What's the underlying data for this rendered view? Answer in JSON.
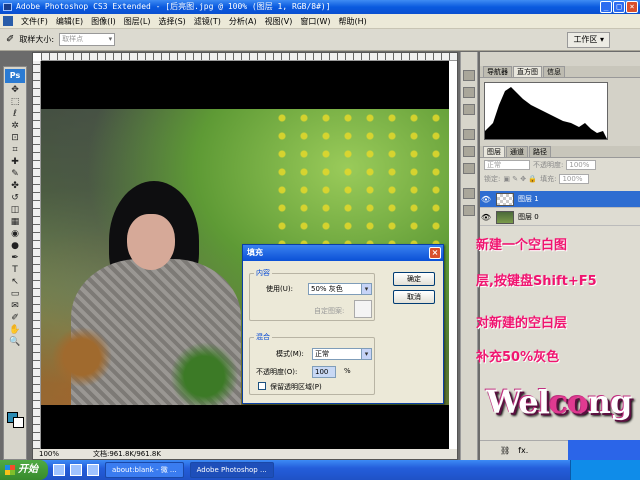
{
  "window": {
    "title": "Adobe Photoshop CS3 Extended - [后亮图.jpg @ 100% (图层 1, RGB/8#)]",
    "minimize_glyph": "_",
    "maximize_glyph": "□",
    "close_glyph": "×"
  },
  "menubar": {
    "items": [
      "文件(F)",
      "编辑(E)",
      "图像(I)",
      "图层(L)",
      "选择(S)",
      "滤镜(T)",
      "分析(A)",
      "视图(V)",
      "窗口(W)",
      "帮助(H)"
    ]
  },
  "options_bar": {
    "sample_size_label": "取样大小:",
    "sample_size_value": "取样点",
    "workspace_label": "工作区 ▾"
  },
  "toolbox": {
    "logo": "Ps",
    "tools": [
      "move-icon",
      "marquee-icon",
      "lasso-icon",
      "magic-wand-icon",
      "crop-icon",
      "slice-icon",
      "healing-icon",
      "brush-icon",
      "stamp-icon",
      "history-brush-icon",
      "eraser-icon",
      "gradient-icon",
      "blur-icon",
      "dodge-icon",
      "pen-icon",
      "type-icon",
      "path-select-icon",
      "shape-icon",
      "notes-icon",
      "eyedropper-icon",
      "hand-icon",
      "zoom-icon"
    ],
    "tool_glyphs": [
      "✥",
      "⬚",
      "ℓ",
      "✲",
      "⊡",
      "⌗",
      "✚",
      "✎",
      "✤",
      "↺",
      "◫",
      "▦",
      "◉",
      "●",
      "✒",
      "T",
      "↖",
      "▭",
      "✉",
      "✐",
      "✋",
      "🔍"
    ],
    "fg_color": "#2a8bb4",
    "bg_color": "#ffffff"
  },
  "document": {
    "zoom": "100%",
    "info": "文档:961.8K/961.8K"
  },
  "fill_dialog": {
    "title": "填充",
    "close_glyph": "×",
    "contents_group": "内容",
    "use_label": "使用(U):",
    "use_value": "50% 灰色",
    "custom_pattern_label": "自定图案:",
    "blending_group": "混合",
    "mode_label": "模式(M):",
    "mode_value": "正常",
    "opacity_label": "不透明度(O):",
    "opacity_value": "100",
    "opacity_unit": "%",
    "preserve_label": "保留透明区域(P)",
    "ok_label": "确定",
    "cancel_label": "取消"
  },
  "navigator_panel": {
    "tabs": [
      "导航器",
      "直方图",
      "信息"
    ],
    "active_tab": 1
  },
  "layers_panel": {
    "tabs": [
      "图层",
      "通道",
      "路径"
    ],
    "blend_mode": "正常",
    "opacity_label": "不透明度:",
    "opacity_value": "100%",
    "lock_label": "锁定:",
    "fill_label": "填充:",
    "fill_value": "100%",
    "layers": [
      {
        "name": "图层 1",
        "selected": true
      },
      {
        "name": "图层 0",
        "selected": false
      }
    ],
    "bottom_fx": "fx."
  },
  "annotation": {
    "lines": [
      "新建一个空白图",
      "层,按键盘Shift+F5",
      "对新建的空白层",
      "补充50%灰色"
    ],
    "logo_part1": "Wel",
    "logo_part2": "co",
    "logo_part3": "ng"
  },
  "taskbar": {
    "start_label": "开始",
    "items": [
      "about:blank - 微 ...",
      "Adobe Photoshop ..."
    ],
    "active_index": 1
  },
  "colors": {
    "annotation": "#f01470",
    "selection": "#2e6dd1",
    "xp_blue": "#0a5adf"
  }
}
